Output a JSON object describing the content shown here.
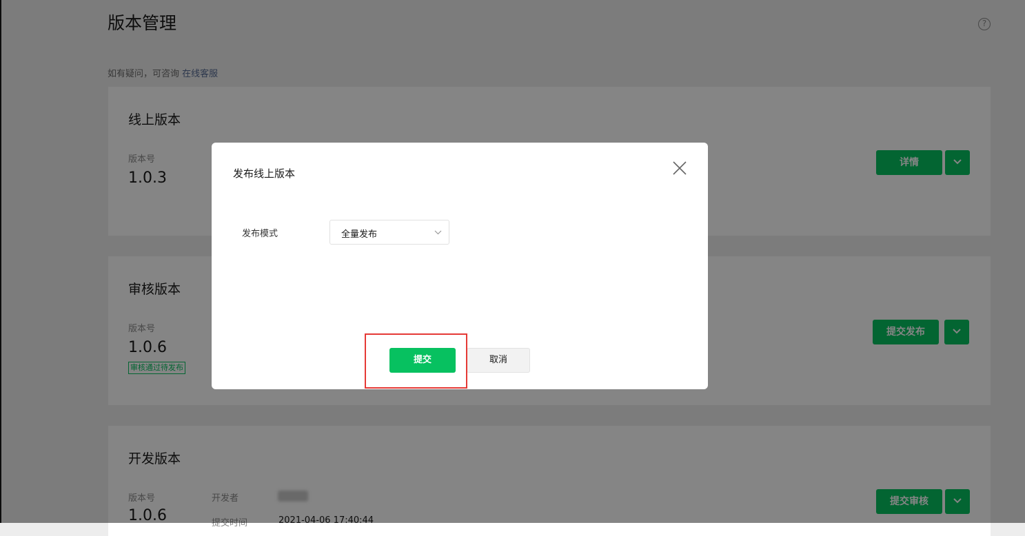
{
  "page": {
    "title": "版本管理",
    "help_icon": "question-circle-icon",
    "hint_text": "如有疑问，可咨询 ",
    "hint_link": "在线客服"
  },
  "online": {
    "title": "线上版本",
    "version_label": "版本号",
    "version": "1.0.3",
    "primary_button": "详情"
  },
  "review": {
    "title": "审核版本",
    "version_label": "版本号",
    "version": "1.0.6",
    "status_badge": "审核通过待发布",
    "primary_button": "提交发布"
  },
  "dev": {
    "title": "开发版本",
    "version_label": "版本号",
    "version": "1.0.6",
    "developer_label": "开发者",
    "submit_time_label": "提交时间",
    "submit_time": "2021-04-06 17:40:44",
    "primary_button": "提交审核"
  },
  "dialog": {
    "title": "发布线上版本",
    "field_label": "发布模式",
    "select_value": "全量发布",
    "submit_label": "提交",
    "cancel_label": "取消"
  },
  "colors": {
    "brand_green": "#07c160",
    "highlight_red": "#e53935"
  }
}
